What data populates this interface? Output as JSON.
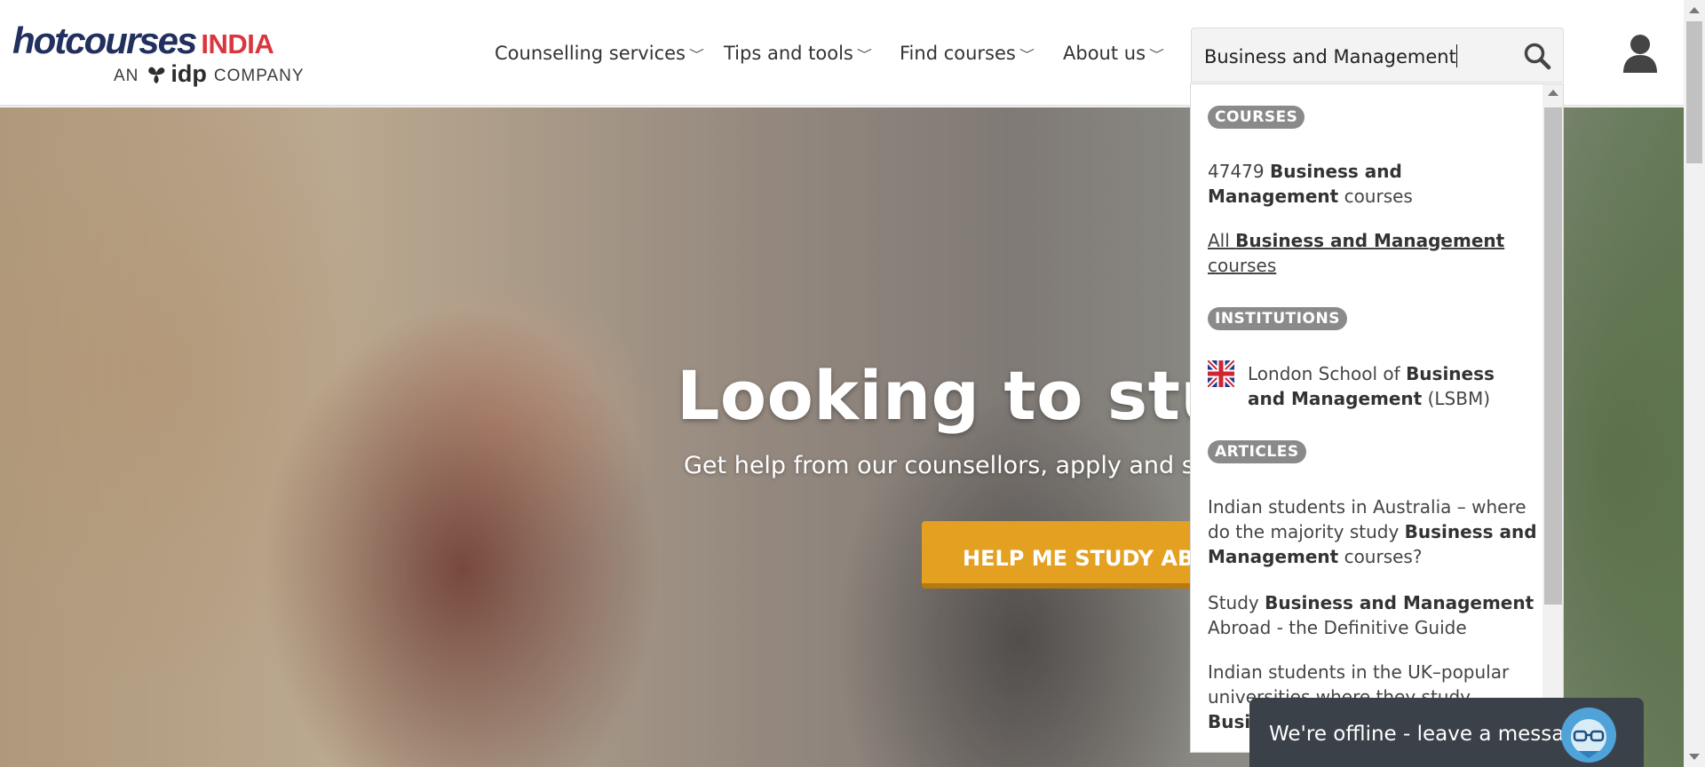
{
  "logo": {
    "brand": "hotcourses",
    "region": "INDIA",
    "tagline_prefix": "AN",
    "tagline_brand": "idp",
    "tagline_suffix": "COMPANY",
    "colors": {
      "brand": "#22305f",
      "region": "#d9363e"
    }
  },
  "nav": {
    "items": [
      {
        "label": "Counselling services",
        "icon": "chevron-down-icon"
      },
      {
        "label": "Tips and tools",
        "icon": "chevron-down-icon"
      },
      {
        "label": "Find courses",
        "icon": "chevron-down-icon"
      },
      {
        "label": "About us",
        "icon": "chevron-down-icon"
      }
    ]
  },
  "search": {
    "value": "Business and Management",
    "icon": "search-icon"
  },
  "user": {
    "icon": "user-icon"
  },
  "hero": {
    "title": "Looking to stud",
    "subtitle": "Get help from our counsellors, apply and stuc",
    "cta": "HELP ME STUDY ABRO",
    "cta_color": "#e4a020"
  },
  "dropdown": {
    "sections": {
      "courses": "COURSES",
      "institutions": "INSTITUTIONS",
      "articles": "ARTICLES"
    },
    "courses": [
      {
        "prefix": "47479 ",
        "bold": "Business and Management",
        "suffix": " courses"
      },
      {
        "prefix": "All ",
        "bold": "Business and Management",
        "suffix": " courses"
      }
    ],
    "institutions": [
      {
        "prefix": "London School of ",
        "bold": "Business and Management",
        "suffix": " (LSBM)",
        "flag": "uk-flag-icon"
      }
    ],
    "articles": [
      {
        "prefix": "Indian students in Australia – where do the majority study ",
        "bold": "Business and Management",
        "suffix": " courses?"
      },
      {
        "prefix": "Study ",
        "bold": "Business and Management",
        "suffix": " Abroad - the Definitive Guide"
      },
      {
        "prefix": "Indian students in the UK–popular universities where they study ",
        "bold": "Business and Management",
        "suffix": ""
      }
    ],
    "badge_color": "#8a8a8a"
  },
  "chat": {
    "label": "We're offline - leave a message",
    "icon": "chat-bot-avatar-icon",
    "color": "#3b4149"
  }
}
